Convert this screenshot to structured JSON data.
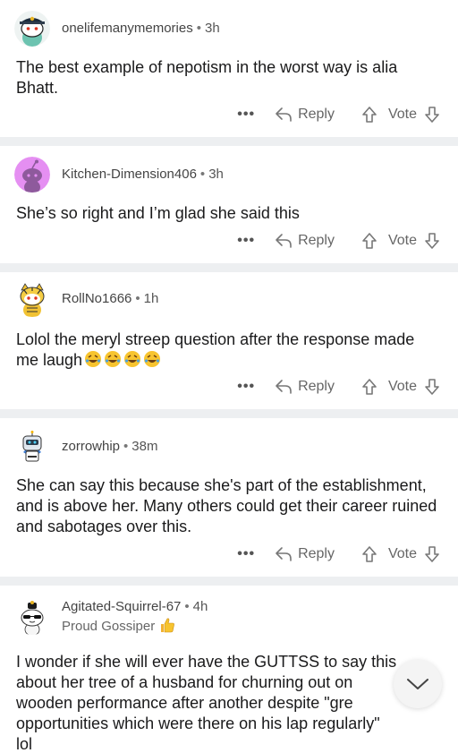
{
  "actions": {
    "more": "•••",
    "reply": "Reply",
    "vote": "Vote"
  },
  "comments": [
    {
      "username": "onelifemanymemories",
      "dot": "•",
      "time": "3h",
      "text": "The best example of nepotism in the worst way is alia Bhatt.",
      "avatar": "avatar-hat-icon"
    },
    {
      "username": "Kitchen-Dimension406",
      "dot": "•",
      "time": "3h",
      "text": "She’s so right and I’m glad she said this",
      "avatar": "avatar-default-icon"
    },
    {
      "username": "RollNo1666",
      "dot": "•",
      "time": "1h",
      "text": "Lolol the meryl streep question after the response made me laugh",
      "emojis": [
        "rofl-emoji",
        "rofl-emoji",
        "rofl-emoji",
        "rofl-emoji"
      ],
      "avatar": "avatar-tiger-icon"
    },
    {
      "username": "zorrowhip",
      "dot": "•",
      "time": "38m",
      "text": "She can say this because she's part of the establishment, and is above her. Many others could get their career ruined and sabotages over this.",
      "avatar": "avatar-robot-icon"
    },
    {
      "username": "Agitated-Squirrel-67",
      "dot": "•",
      "time": "4h",
      "flair": "Proud Gossiper",
      "flair_emoji": "thumbs-up-emoji",
      "text_lines": [
        "I wonder if she will ever have the GUTTSS to say this",
        "about her tree of a husband for churning out on",
        "wooden performance after another despite \"gre",
        "opportunities which were there on his lap regularly\"",
        "lol"
      ],
      "avatar": "avatar-sunglasses-icon"
    }
  ],
  "scroll_button": {
    "icon": "chevron-down-icon"
  }
}
